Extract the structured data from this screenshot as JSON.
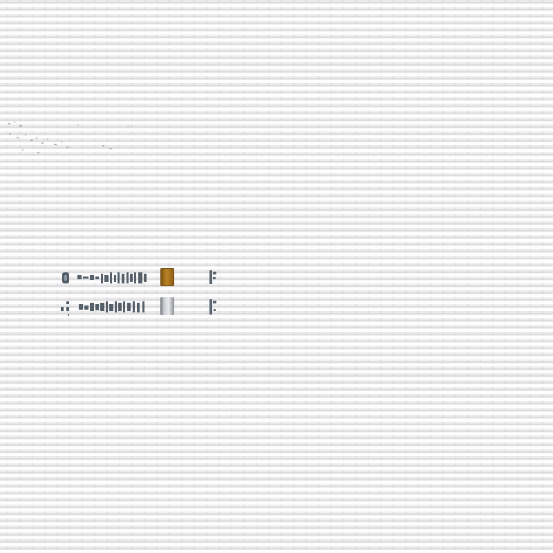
{
  "background": {
    "texture": "woven-canvas",
    "base_color": "#f1f1f2"
  },
  "speckle": {
    "icon": "noise-speckle-icon",
    "color": "#6f7278"
  },
  "rows": [
    {
      "leading_icon": "dot-marker-icon",
      "glyph_icon": "illegible-glyphs-icon",
      "swatch_icon": "color-swatch-icon",
      "swatch_color": "#b07a20",
      "swatch_state": "active",
      "tail_icon": "small-mark-icon",
      "ink_color": "#4f5a66"
    },
    {
      "leading_icon": "dot-marker-icon",
      "glyph_icon": "illegible-glyphs-icon",
      "swatch_icon": "color-swatch-icon",
      "swatch_color": "#c9cbd0",
      "swatch_state": "inactive",
      "tail_icon": "small-mark-icon",
      "ink_color": "#4f5a66"
    }
  ]
}
